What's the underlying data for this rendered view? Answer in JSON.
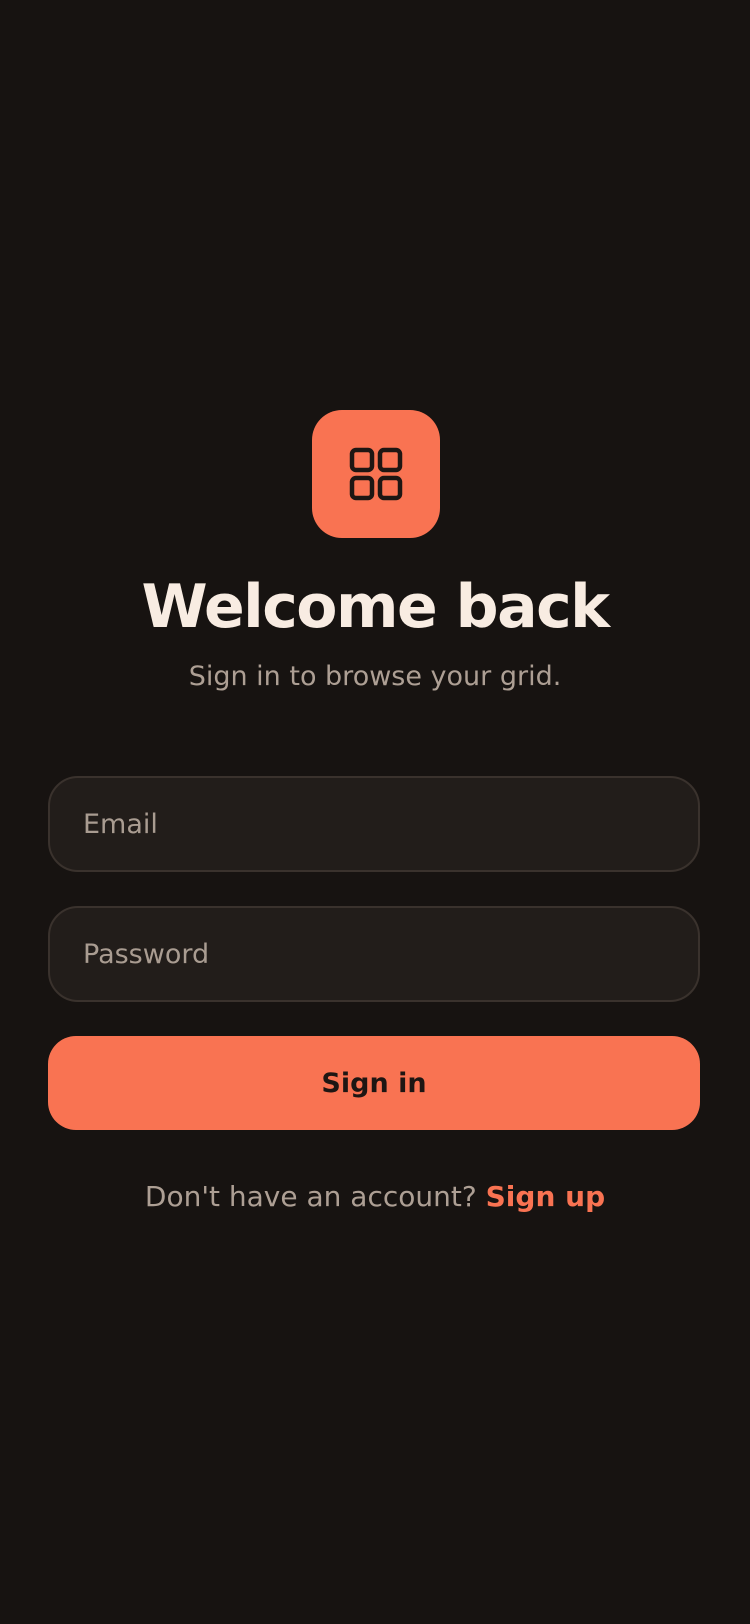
{
  "app": {
    "logo_icon": "grid-icon",
    "accent_color": "#f97352",
    "background_color": "#171311"
  },
  "header": {
    "title": "Welcome back",
    "subtitle": "Sign in to browse your grid."
  },
  "form": {
    "email_placeholder": "Email",
    "email_value": "",
    "password_placeholder": "Password",
    "password_value": "",
    "submit_label": "Sign in"
  },
  "footer": {
    "prompt": "Don't have an account?",
    "link_label": "Sign up"
  }
}
